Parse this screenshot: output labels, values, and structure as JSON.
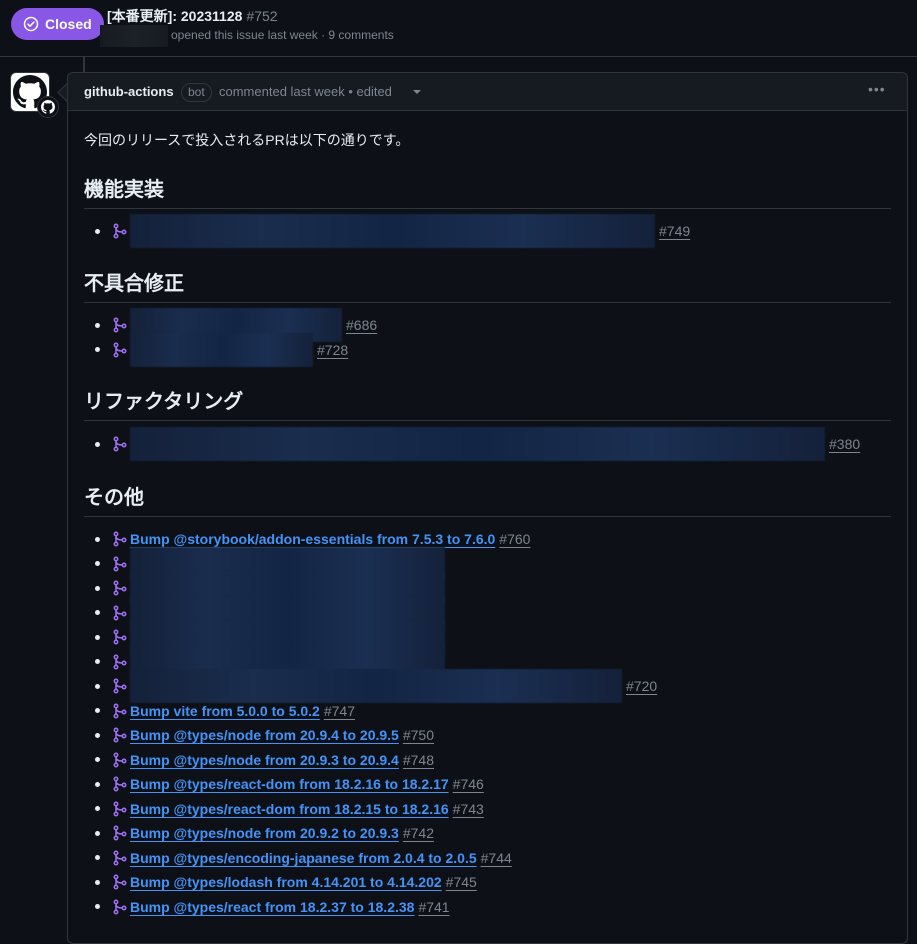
{
  "issue": {
    "state_label": "Closed",
    "title": "[本番更新]: 20231128",
    "number": "#752",
    "meta": "opened this issue last week · 9 comments"
  },
  "comment": {
    "author": "github-actions",
    "bot_label": "bot",
    "meta": "commented last week • edited",
    "intro": "今回のリリースで投入されるPRは以下の通りです。",
    "sections": [
      {
        "heading": "機能実装",
        "items": [
          {
            "link_text": "",
            "number": "#749",
            "redacted": true
          }
        ]
      },
      {
        "heading": "不具合修正",
        "items": [
          {
            "link_text": "",
            "number": "#686",
            "redacted": true
          },
          {
            "link_text": "",
            "number": "#728",
            "redacted": true
          }
        ]
      },
      {
        "heading": "リファクタリング",
        "items": [
          {
            "link_text": "",
            "number": "#380",
            "redacted": true
          }
        ]
      },
      {
        "heading": "その他",
        "items": [
          {
            "link_text": "Bump @storybook/addon-essentials from 7.5.3 to 7.6.0",
            "number": "#760",
            "redacted": false
          },
          {
            "link_text": "",
            "number": "",
            "redacted": true
          },
          {
            "link_text": "",
            "number": "",
            "redacted": true
          },
          {
            "link_text": "",
            "number": "",
            "redacted": true
          },
          {
            "link_text": "",
            "number": "",
            "redacted": true
          },
          {
            "link_text": "",
            "number": "",
            "redacted": true
          },
          {
            "link_text": "",
            "number": "#720",
            "redacted": true
          },
          {
            "link_text": "Bump vite from 5.0.0 to 5.0.2",
            "number": "#747",
            "redacted": false
          },
          {
            "link_text": "Bump @types/node from 20.9.4 to 20.9.5",
            "number": "#750",
            "redacted": false
          },
          {
            "link_text": "Bump @types/node from 20.9.3 to 20.9.4",
            "number": "#748",
            "redacted": false
          },
          {
            "link_text": "Bump @types/react-dom from 18.2.16 to 18.2.17",
            "number": "#746",
            "redacted": false
          },
          {
            "link_text": "Bump @types/react-dom from 18.2.15 to 18.2.16",
            "number": "#743",
            "redacted": false
          },
          {
            "link_text": "Bump @types/node from 20.9.2 to 20.9.3",
            "number": "#742",
            "redacted": false
          },
          {
            "link_text": "Bump @types/encoding-japanese from 2.0.4 to 2.0.5",
            "number": "#744",
            "redacted": false
          },
          {
            "link_text": "Bump @types/lodash from 4.14.201 to 4.14.202",
            "number": "#745",
            "redacted": false
          },
          {
            "link_text": "Bump @types/react from 18.2.37 to 18.2.38",
            "number": "#741",
            "redacted": false
          }
        ]
      }
    ]
  },
  "colors": {
    "closed_badge": "#8957e5",
    "link": "#4493f8",
    "muted": "#7d8590",
    "background": "#0d1117"
  }
}
